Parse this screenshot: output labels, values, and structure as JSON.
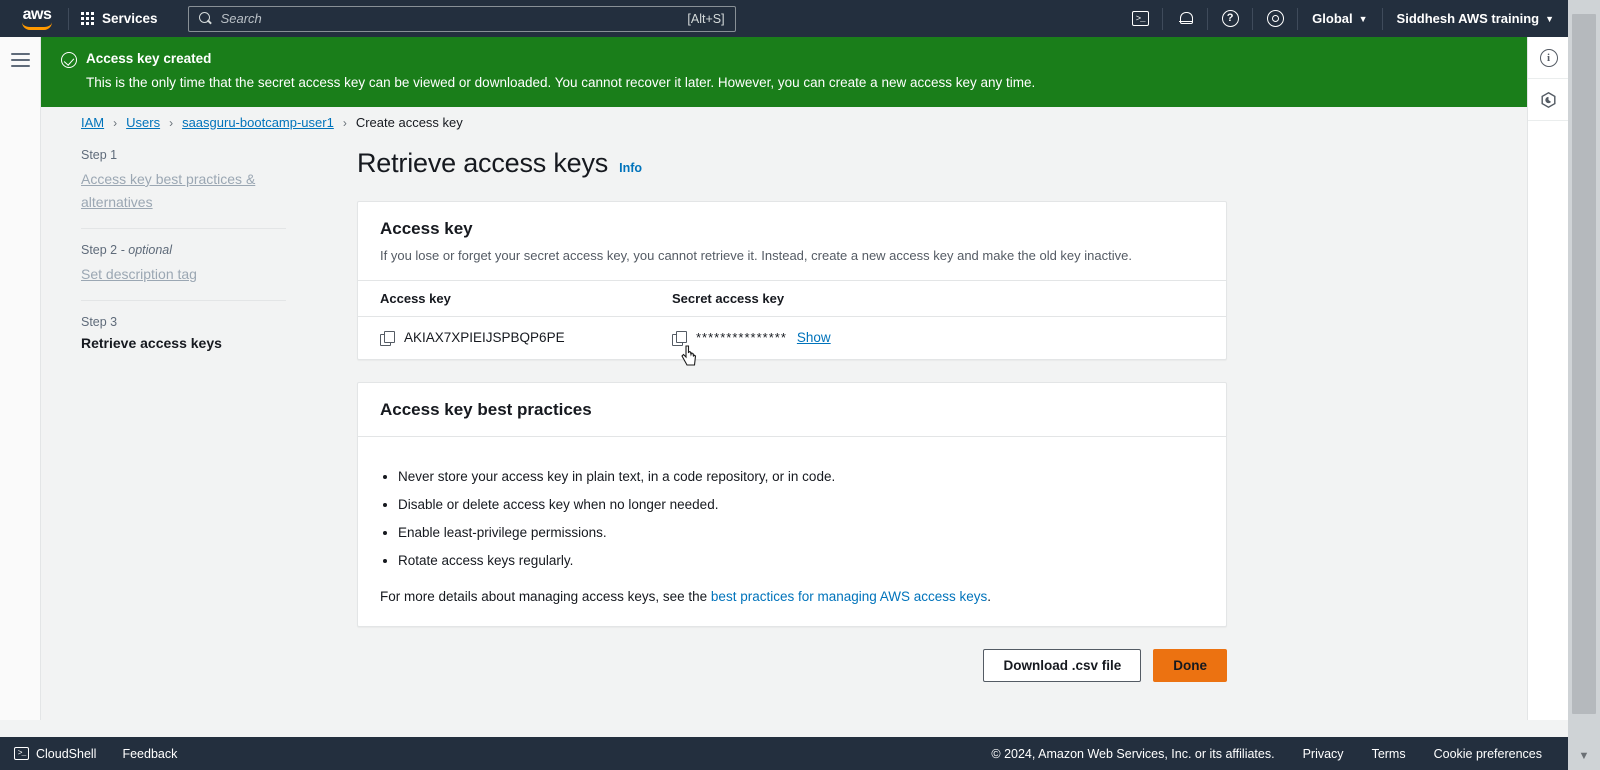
{
  "topnav": {
    "logo_text": "aws",
    "services_label": "Services",
    "search_placeholder": "Search",
    "search_value": "",
    "search_shortcut": "[Alt+S]",
    "cloudshell_icon": "cloudshell-icon",
    "notifications_icon": "bell-icon",
    "help_icon": "question-mark-icon",
    "settings_icon": "gear-icon",
    "region_label": "Global",
    "account_label": "Siddhesh AWS training"
  },
  "banner": {
    "status_icon": "check-circle-icon",
    "title": "Access key created",
    "message": "This is the only time that the secret access key can be viewed or downloaded. You cannot recover it later. However, you can create a new access key any time.",
    "color": "#1a7e1a"
  },
  "breadcrumb": {
    "items": [
      {
        "label": "IAM",
        "link": true
      },
      {
        "label": "Users",
        "link": true
      },
      {
        "label": "saasguru-bootcamp-user1",
        "link": true
      },
      {
        "label": "Create access key",
        "link": false
      }
    ],
    "separator": "›"
  },
  "steps": [
    {
      "number": "Step 1",
      "optional": "",
      "label": "Access key best practices & alternatives",
      "current": false
    },
    {
      "number": "Step 2",
      "optional": " - optional",
      "label": "Set description tag",
      "current": false
    },
    {
      "number": "Step 3",
      "optional": "",
      "label": "Retrieve access keys",
      "current": true
    }
  ],
  "main": {
    "page_title": "Retrieve access keys",
    "info_label": "Info",
    "access_key_card": {
      "title": "Access key",
      "subtitle": "If you lose or forget your secret access key, you cannot retrieve it. Instead, create a new access key and make the old key inactive.",
      "columns": [
        "Access key",
        "Secret access key"
      ],
      "access_key_value": "AKIAX7XPIEIJSPBQP6PE",
      "secret_masked": "***************",
      "show_label": "Show",
      "copy_icon": "copy-icon"
    },
    "best_practices_card": {
      "title": "Access key best practices",
      "bullets": [
        "Never store your access key in plain text, in a code repository, or in code.",
        "Disable or delete access key when no longer needed.",
        "Enable least-privilege permissions.",
        "Rotate access keys regularly."
      ],
      "footer_prefix": "For more details about managing access keys, see the ",
      "footer_link": "best practices for managing AWS access keys",
      "footer_suffix": "."
    },
    "actions": {
      "download_label": "Download .csv file",
      "done_label": "Done",
      "primary_color": "#ec7211"
    }
  },
  "right_rail": {
    "info_panel_icon": "info-circle-icon",
    "shortcuts_icon": "hexagon-icon"
  },
  "bottombar": {
    "cloudshell_label": "CloudShell",
    "feedback_label": "Feedback",
    "copyright": "© 2024, Amazon Web Services, Inc. or its affiliates.",
    "privacy_label": "Privacy",
    "terms_label": "Terms",
    "cookie_label": "Cookie preferences"
  }
}
